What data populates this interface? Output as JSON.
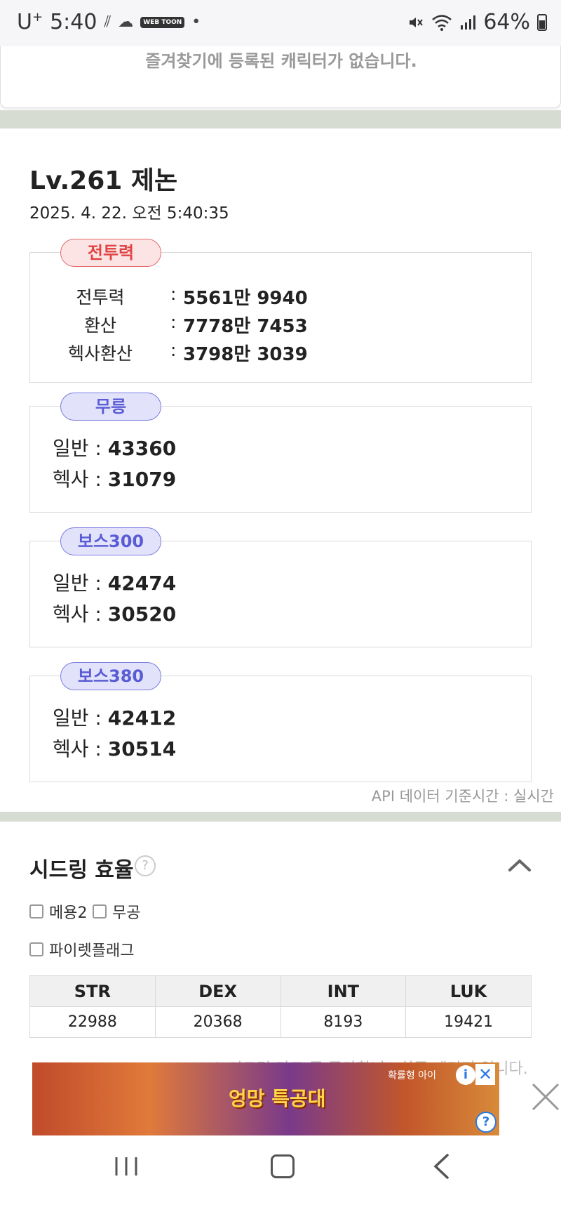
{
  "status_bar": {
    "carrier": "U",
    "carrier_sup": "+",
    "time": "5:40",
    "webtoon_badge": "WEB TOON",
    "dot": "•",
    "battery": "64%"
  },
  "favorites": {
    "empty_message": "즐겨찾기에 등록된 캐릭터가 없습니다."
  },
  "character": {
    "title": "Lv.261 제논",
    "timestamp": "2025. 4. 22. 오전 5:40:35"
  },
  "combat_power": {
    "pill": "전투력",
    "rows": [
      {
        "label": "전투력",
        "value": "5561만 9940"
      },
      {
        "label": "환산",
        "value": "7778만 7453"
      },
      {
        "label": "헥사환산",
        "value": "3798만 3039"
      }
    ]
  },
  "damage_sections": [
    {
      "pill": "무릉",
      "general_label": "일반 :",
      "general": "43360",
      "hexa_label": "헥사 :",
      "hexa": "31079"
    },
    {
      "pill": "보스300",
      "general_label": "일반 :",
      "general": "42474",
      "hexa_label": "헥사 :",
      "hexa": "30520"
    },
    {
      "pill": "보스380",
      "general_label": "일반 :",
      "general": "42412",
      "hexa_label": "헥사 :",
      "hexa": "30514"
    }
  ],
  "api_note": "API 데이터 기준시간 : 실시간",
  "seed": {
    "title": "시드링 효율",
    "help": "?",
    "checkboxes": [
      "메용2",
      "무공",
      "파이렛플래그"
    ],
    "table": {
      "headers": [
        "STR",
        "DEX",
        "INT",
        "LUK"
      ],
      "values": [
        "22988",
        "20368",
        "8193",
        "19421"
      ]
    },
    "note": "※ 시드링 가드 존 증가합니 · 최종 데미지 입니다."
  },
  "ad": {
    "logo": "엉망 특공대",
    "label": "확률형 아이",
    "info": "i",
    "close": "✕",
    "question": "?"
  },
  "colors": {
    "separator": "#d7dcd3",
    "pill_red": "#e04444",
    "pill_blue": "#5a5cd6"
  }
}
